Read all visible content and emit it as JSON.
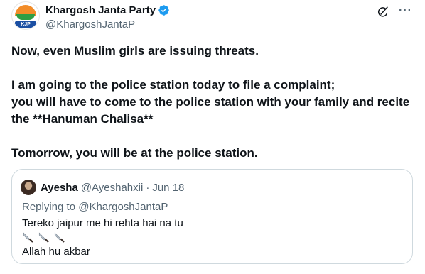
{
  "author": {
    "display_name": "Khargosh Janta Party",
    "handle": "@KhargoshJantaP",
    "avatar_badge": "KJP"
  },
  "icons": {
    "verified": "verified-badge-icon",
    "grok": "grok-icon",
    "more": "more-options-icon"
  },
  "tweet": {
    "line1": "Now, even Muslim girls are issuing threats.",
    "line2": "I am going to the police station today to file a complaint;",
    "line3": "you will have to come to the police station with your family and recite",
    "line4": "the **Hanuman Chalisa**",
    "line5": "Tomorrow, you will be at the police station."
  },
  "quote": {
    "display_name": "Ayesha",
    "handle": "@Ayeshahxii",
    "separator": "·",
    "date": "Jun 18",
    "replying_to": "Replying to @KhargoshJantaP",
    "text_line1": "Tereko jaipur me hi rehta hai na tu",
    "knife_count": 3,
    "text_line3": "Allah hu akbar"
  },
  "colors": {
    "verified_blue": "#1d9bf0",
    "secondary_text": "#536471",
    "border": "#cfd9de"
  }
}
